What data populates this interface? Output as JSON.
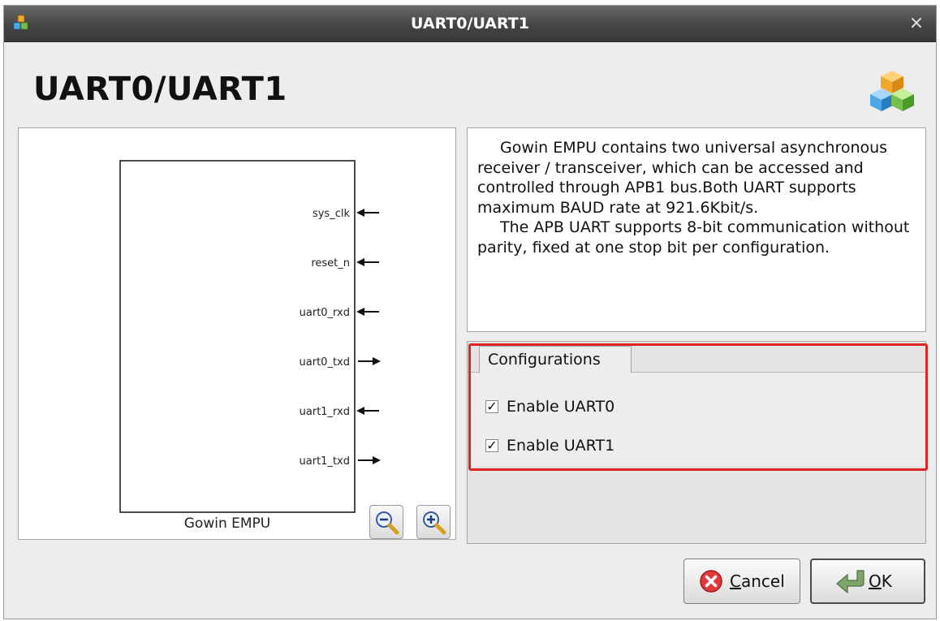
{
  "window": {
    "title": "UART0/UART1",
    "close_glyph": "×"
  },
  "header": {
    "title": "UART0/UART1",
    "icon": "cubes-icon"
  },
  "diagram": {
    "block_name": "Gowin EMPU",
    "ports": [
      {
        "label": "sys_clk",
        "direction": "in"
      },
      {
        "label": "reset_n",
        "direction": "in"
      },
      {
        "label": "uart0_rxd",
        "direction": "in"
      },
      {
        "label": "uart0_txd",
        "direction": "out"
      },
      {
        "label": "uart1_rxd",
        "direction": "in"
      },
      {
        "label": "uart1_txd",
        "direction": "out"
      }
    ],
    "zoom_out_icon": "zoom-out-icon",
    "zoom_in_icon": "zoom-in-icon"
  },
  "description": {
    "p1": "Gowin EMPU contains two universal asynchronous receiver / transceiver, which can be accessed and controlled through APB1 bus.Both UART supports maximum BAUD rate at 921.6Kbit/s.",
    "p2": "The APB UART supports 8-bit communication without parity, fixed at one stop bit per configuration."
  },
  "configurations": {
    "tab_label": "Configurations",
    "options": [
      {
        "label": "Enable UART0",
        "checked": true
      },
      {
        "label": "Enable UART1",
        "checked": true
      }
    ],
    "check_glyph": "✓",
    "highlight_color": "#e02424"
  },
  "buttons": {
    "cancel": {
      "label_underlined": "C",
      "label_rest": "ancel",
      "icon": "cancel-x-icon"
    },
    "ok": {
      "label_underlined": "O",
      "label_rest": "K",
      "icon": "ok-arrow-icon"
    }
  }
}
